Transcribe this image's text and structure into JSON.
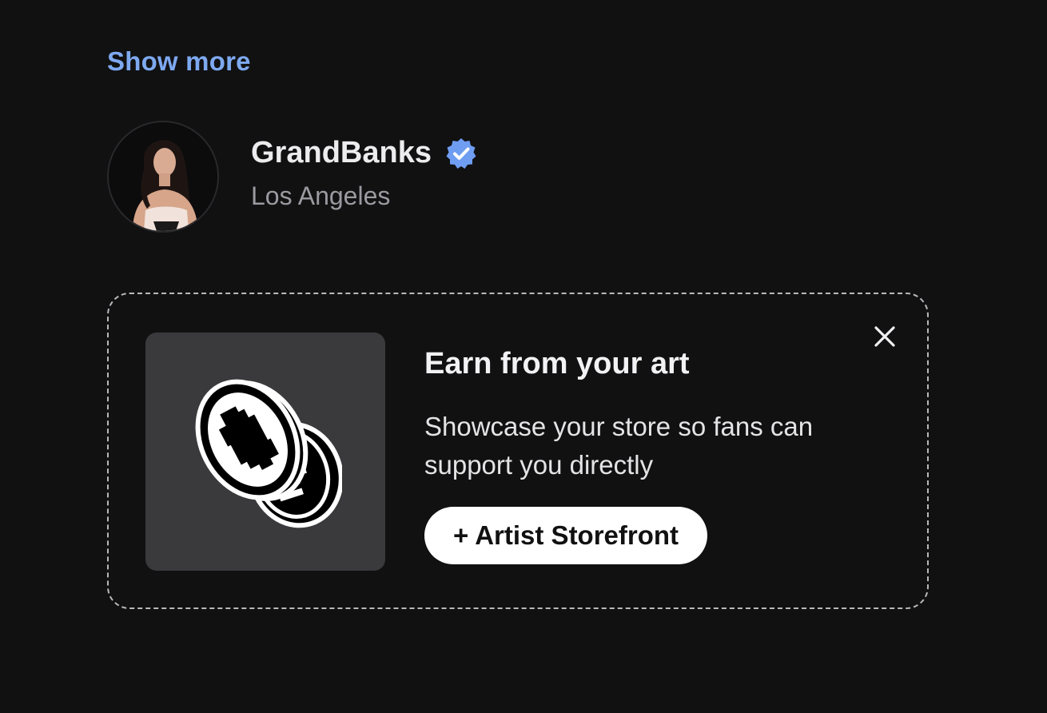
{
  "show_more": {
    "label": "Show more"
  },
  "profile": {
    "name": "GrandBanks",
    "location": "Los Angeles",
    "verified": true,
    "icons": {
      "verified": "verified-badge-icon",
      "avatar": "profile-photo"
    }
  },
  "promo": {
    "title": "Earn from your art",
    "description": "Showcase your store so fans can support you directly",
    "button_label": "+ Artist Storefront",
    "icons": {
      "illustration": "coins-icon",
      "close": "close-icon"
    }
  },
  "colors": {
    "background": "#111112",
    "link": "#7ea9f0",
    "verified": "#6f9df2",
    "tile": "#3a3a3c",
    "button": "#ffffff"
  }
}
